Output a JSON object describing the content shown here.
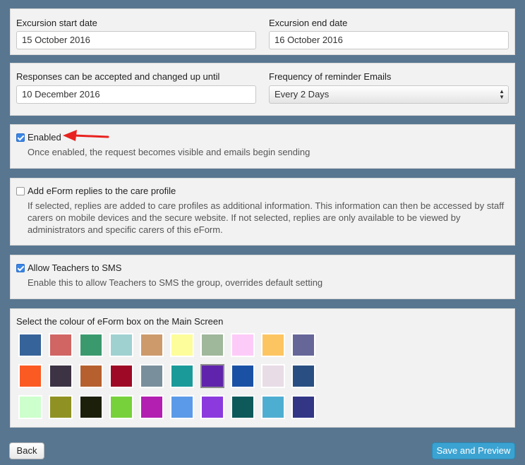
{
  "dates": {
    "start_label": "Excursion start date",
    "start_value": "15 October 2016",
    "end_label": "Excursion end date",
    "end_value": "16 October 2016"
  },
  "responses": {
    "until_label": "Responses can be accepted and changed up until",
    "until_value": "10 December 2016",
    "frequency_label": "Frequency of reminder Emails",
    "frequency_value": "Every 2 Days"
  },
  "enabled": {
    "label": "Enabled",
    "checked": true,
    "description": "Once enabled, the request becomes visible and emails begin sending"
  },
  "care_profile": {
    "label": "Add eForm replies to the care profile",
    "checked": false,
    "description": "If selected, replies are added to care profiles as additional information. This information can then be accessed by staff carers on mobile devices and the secure website. If not selected, replies are only available to be viewed by administrators and specific carers of this eForm."
  },
  "sms": {
    "label": "Allow Teachers to SMS",
    "checked": true,
    "description": "Enable this to allow Teachers to SMS the group, overrides default setting"
  },
  "colours": {
    "label": "Select the colour of eForm box on the Main Screen",
    "selected_index": 16,
    "swatches": [
      "#36639a",
      "#d06564",
      "#3a9a6e",
      "#9fd1d1",
      "#cd9a6c",
      "#fdfd9b",
      "#9fb79b",
      "#fdcbf8",
      "#fdc561",
      "#666699",
      "#fb5a23",
      "#3c3344",
      "#b5602e",
      "#9e0a25",
      "#7a8f9c",
      "#1a9a99",
      "#6023ac",
      "#1a51a5",
      "#e8dce6",
      "#294f82",
      "#ccffcc",
      "#8f9222",
      "#1c1f0a",
      "#77d13b",
      "#b31fb1",
      "#5b9ae8",
      "#8c3ade",
      "#0e5a5b",
      "#4eaed1",
      "#323685"
    ]
  },
  "buttons": {
    "back": "Back",
    "save": "Save and Preview"
  },
  "annotation": {
    "arrow_color": "#e8231f"
  }
}
